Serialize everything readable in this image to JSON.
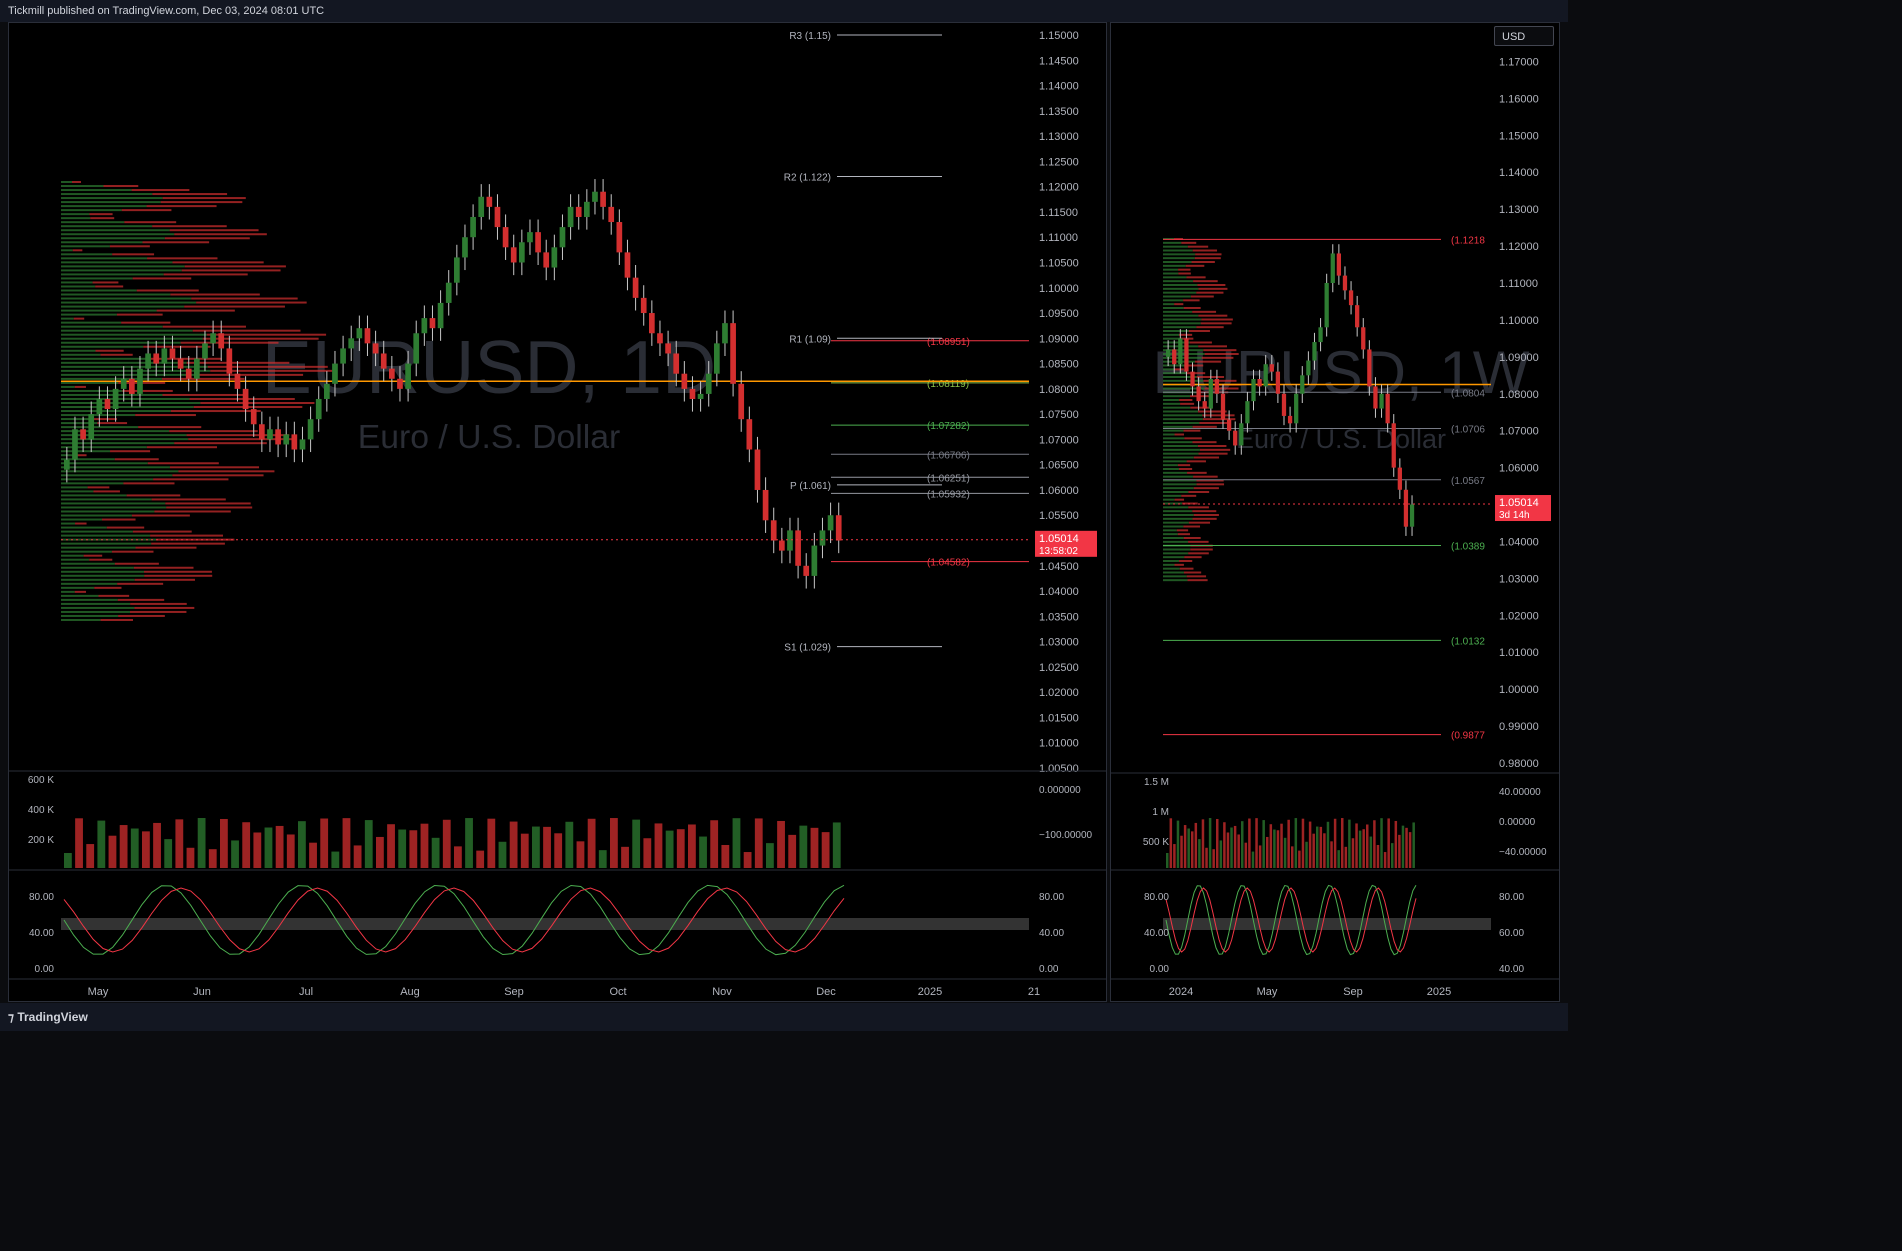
{
  "header": {
    "published_by": "Tickmill published on TradingView.com, Dec 03, 2024 08:01 UTC"
  },
  "footer": {
    "brand": "TradingView"
  },
  "currency_button": "USD",
  "colors": {
    "up": "#2e7d32",
    "down": "#d32f2f",
    "price_tag": "#f23645",
    "orange_line": "#ff9800"
  },
  "chart_data": [
    {
      "type": "candlestick",
      "symbol_watermark": "EURUSD, 1D",
      "subtitle_watermark": "Euro / U.S. Dollar",
      "ylim": [
        1.005,
        1.15
      ],
      "y_ticks": [
        "1.15000",
        "1.14500",
        "1.14000",
        "1.13500",
        "1.13000",
        "1.12500",
        "1.12000",
        "1.11500",
        "1.11000",
        "1.10500",
        "1.10000",
        "1.09500",
        "1.09000",
        "1.08500",
        "1.08000",
        "1.07500",
        "1.07000",
        "1.06500",
        "1.06000",
        "1.05500",
        "1.05000",
        "1.04500",
        "1.04000",
        "1.03500",
        "1.03000",
        "1.02500",
        "1.02000",
        "1.01500",
        "1.01000",
        "1.00500"
      ],
      "x_ticks": [
        "May",
        "Jun",
        "Jul",
        "Aug",
        "Sep",
        "Oct",
        "Nov",
        "Dec",
        "2025",
        "21"
      ],
      "last_price": "1.05014",
      "countdown": "13:58:02",
      "pivot_levels": [
        {
          "label": "R3 (1.15)",
          "value": 1.15
        },
        {
          "label": "R2 (1.122)",
          "value": 1.122
        },
        {
          "label": "R1 (1.09)",
          "value": 1.09
        },
        {
          "label": "P (1.061)",
          "value": 1.061
        },
        {
          "label": "S1 (1.029)",
          "value": 1.029
        }
      ],
      "price_level_labels": [
        {
          "label": "(1.08951)",
          "value": 1.08951,
          "color": "#f23645"
        },
        {
          "label": "(1.08119)",
          "value": 1.08119,
          "color": "#8bc34a"
        },
        {
          "label": "(1.07282)",
          "value": 1.07282,
          "color": "#4caf50"
        },
        {
          "label": "(1.06706)",
          "value": 1.06706,
          "color": "#787b86"
        },
        {
          "label": "(1.06251)",
          "value": 1.06251,
          "color": "#9598a1"
        },
        {
          "label": "(1.05932)",
          "value": 1.05932,
          "color": "#9598a1"
        },
        {
          "label": "(1.04582)",
          "value": 1.04582,
          "color": "#f23645"
        }
      ],
      "closes": [
        1.066,
        1.072,
        1.07,
        1.075,
        1.078,
        1.076,
        1.08,
        1.082,
        1.079,
        1.084,
        1.087,
        1.085,
        1.088,
        1.086,
        1.084,
        1.082,
        1.086,
        1.089,
        1.091,
        1.088,
        1.083,
        1.08,
        1.076,
        1.073,
        1.07,
        1.072,
        1.069,
        1.071,
        1.068,
        1.07,
        1.074,
        1.078,
        1.081,
        1.085,
        1.088,
        1.09,
        1.092,
        1.089,
        1.087,
        1.084,
        1.082,
        1.08,
        1.085,
        1.091,
        1.094,
        1.092,
        1.097,
        1.101,
        1.106,
        1.11,
        1.114,
        1.118,
        1.116,
        1.112,
        1.108,
        1.105,
        1.109,
        1.111,
        1.107,
        1.104,
        1.108,
        1.112,
        1.116,
        1.114,
        1.117,
        1.119,
        1.116,
        1.113,
        1.107,
        1.102,
        1.098,
        1.095,
        1.091,
        1.089,
        1.087,
        1.083,
        1.08,
        1.078,
        1.079,
        1.083,
        1.089,
        1.093,
        1.081,
        1.074,
        1.068,
        1.06,
        1.054,
        1.05,
        1.048,
        1.052,
        1.045,
        1.043,
        1.049,
        1.052,
        1.055,
        1.05
      ],
      "volume_ylim": [
        0,
        600000
      ],
      "volume_ticks": [
        "600 K",
        "400 K",
        "200 K"
      ],
      "cvd_ticks": [
        "0.000000",
        "−100.00000"
      ],
      "stoch_ticks": [
        "80.00",
        "40.00",
        "0.00"
      ],
      "stoch_ticks_right": [
        "80.00",
        "40.00",
        "0.00"
      ]
    },
    {
      "type": "candlestick",
      "symbol_watermark": "EURUSD, 1W",
      "subtitle_watermark": "Euro / U.S. Dollar",
      "ylim": [
        0.98,
        1.175
      ],
      "y_ticks": [
        "1.17000",
        "1.16000",
        "1.15000",
        "1.14000",
        "1.13000",
        "1.12000",
        "1.11000",
        "1.10000",
        "1.09000",
        "1.08000",
        "1.07000",
        "1.06000",
        "1.05000",
        "1.04000",
        "1.03000",
        "1.02000",
        "1.01000",
        "1.00000",
        "0.99000",
        "0.98000"
      ],
      "x_ticks": [
        "2024",
        "May",
        "Sep",
        "2025"
      ],
      "last_price": "1.05014",
      "countdown": "3d 14h",
      "price_level_labels": [
        {
          "label": "(1.1218",
          "value": 1.1218,
          "color": "#f23645"
        },
        {
          "label": "(1.0804",
          "value": 1.0804,
          "color": "#787b86"
        },
        {
          "label": "(1.0706",
          "value": 1.0706,
          "color": "#787b86"
        },
        {
          "label": "(1.0567",
          "value": 1.0567,
          "color": "#787b86"
        },
        {
          "label": "(1.0389",
          "value": 1.0389,
          "color": "#4caf50"
        },
        {
          "label": "(1.0132",
          "value": 1.0132,
          "color": "#4caf50"
        },
        {
          "label": "(0.9877",
          "value": 0.9877,
          "color": "#f23645"
        }
      ],
      "closes": [
        1.092,
        1.088,
        1.095,
        1.086,
        1.082,
        1.078,
        1.076,
        1.084,
        1.08,
        1.073,
        1.07,
        1.066,
        1.072,
        1.078,
        1.084,
        1.082,
        1.088,
        1.086,
        1.08,
        1.074,
        1.072,
        1.08,
        1.085,
        1.089,
        1.094,
        1.098,
        1.11,
        1.118,
        1.112,
        1.108,
        1.104,
        1.098,
        1.092,
        1.082,
        1.076,
        1.08,
        1.072,
        1.06,
        1.054,
        1.044,
        1.05
      ],
      "volume_ticks": [
        "1.5 M",
        "1 M",
        "500 K"
      ],
      "cvd_ticks": [
        "40.00000",
        "0.00000",
        "−40.00000"
      ],
      "stoch_ticks": [
        "80.00",
        "40.00",
        "0.00"
      ],
      "stoch_ticks_right": [
        "80.00",
        "60.00",
        "40.00"
      ]
    }
  ]
}
